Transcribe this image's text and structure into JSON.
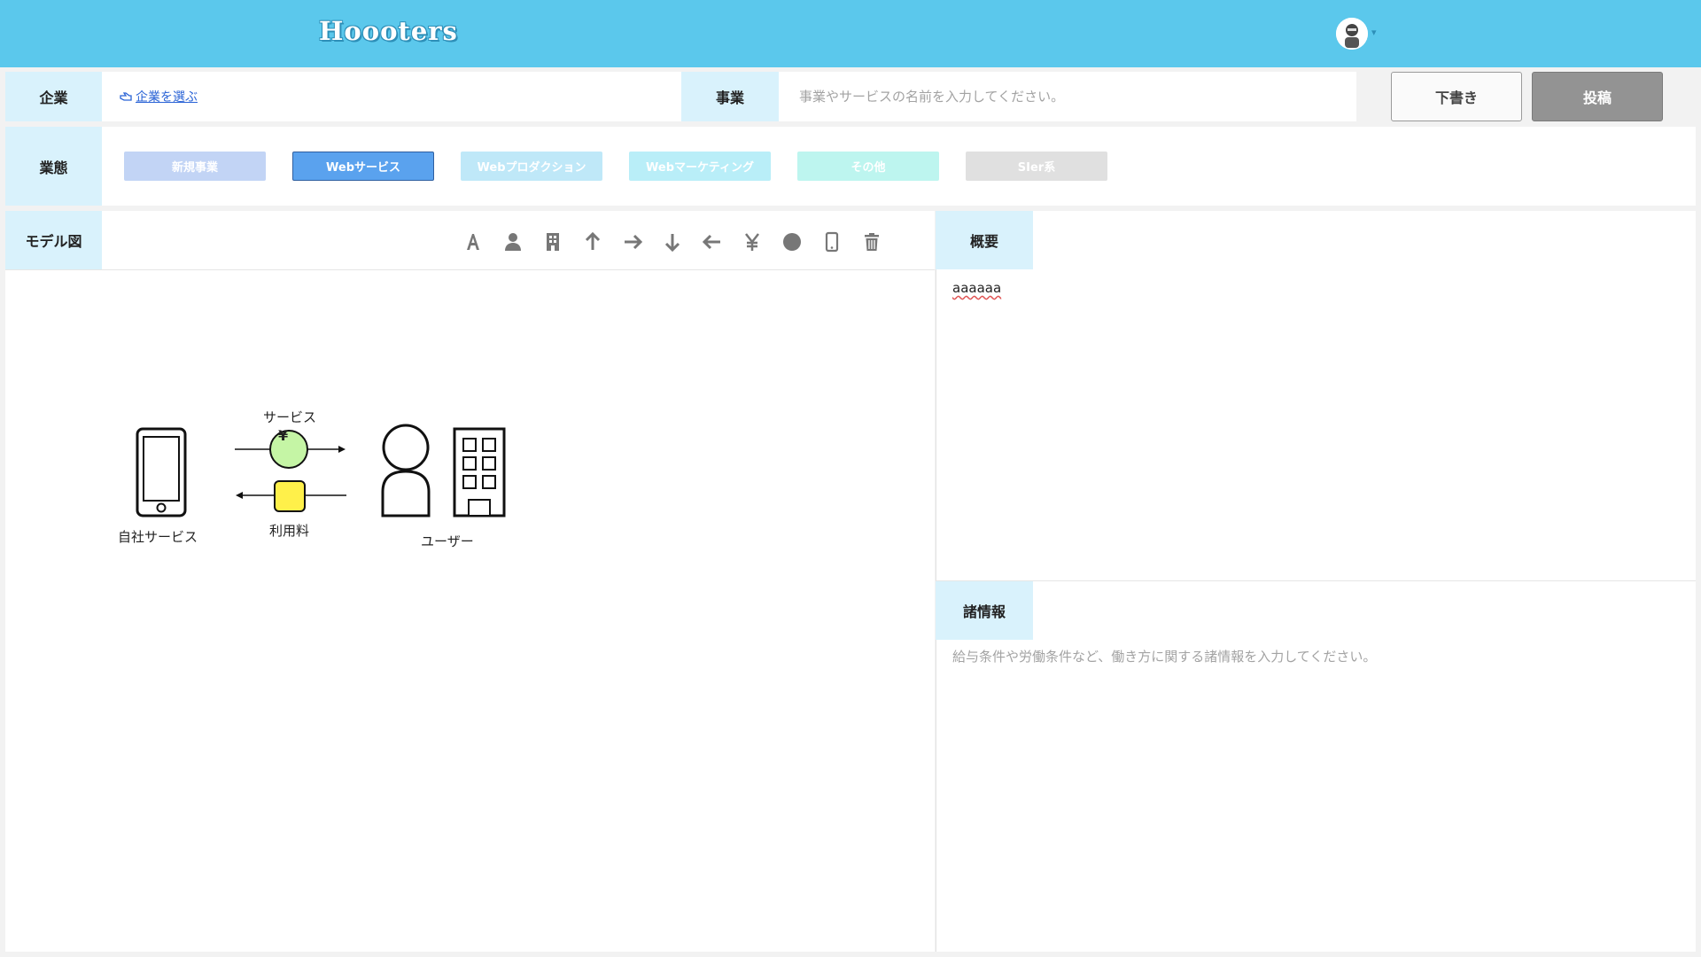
{
  "header": {
    "logo": "Hoooters",
    "avatar_icon": "user-avatar",
    "menu_caret": "▾"
  },
  "company": {
    "label": "企業",
    "choose_link": "企業を選ぶ",
    "choose_icon": "hand-pointing-icon"
  },
  "business": {
    "label": "事業",
    "placeholder": "事業やサービスの名前を入力してください。"
  },
  "actions": {
    "draft": "下書き",
    "post": "投稿"
  },
  "category": {
    "label": "業態",
    "chips": [
      {
        "label": "新規事業",
        "color": "#c2d4f5",
        "selected": false
      },
      {
        "label": "Webサービス",
        "color": "#5aa2ee",
        "selected": true
      },
      {
        "label": "Webプロダクション",
        "color": "#bfe8f8",
        "selected": false
      },
      {
        "label": "Webマーケティング",
        "color": "#b9eef8",
        "selected": false
      },
      {
        "label": "その他",
        "color": "#bdf5ef",
        "selected": false
      },
      {
        "label": "SIer系",
        "color": "#e0e0e0",
        "selected": false
      }
    ]
  },
  "model": {
    "label": "モデル図",
    "tools": [
      "text-icon",
      "person-icon",
      "building-icon",
      "arrow-up-icon",
      "arrow-right-icon",
      "arrow-down-icon",
      "arrow-left-icon",
      "yen-icon",
      "circle-icon",
      "phone-icon",
      "trash-icon"
    ],
    "diagram": {
      "left_node_label": "自社サービス",
      "top_flow_label": "サービス",
      "bottom_flow_label": "利用料",
      "yen_symbol": "¥",
      "right_node_label": "ユーザー",
      "flow_circle_color": "#c5f5a5",
      "yen_box_color": "#fff04a"
    }
  },
  "overview": {
    "label": "概要",
    "text": "aaaaaa"
  },
  "info": {
    "label": "諸情報",
    "placeholder": "給与条件や労働条件など、働き方に関する諸情報を入力してください。"
  },
  "colors": {
    "header": "#5bc8ec",
    "label_bg": "#d9f2fc",
    "post_button": "#939393"
  }
}
